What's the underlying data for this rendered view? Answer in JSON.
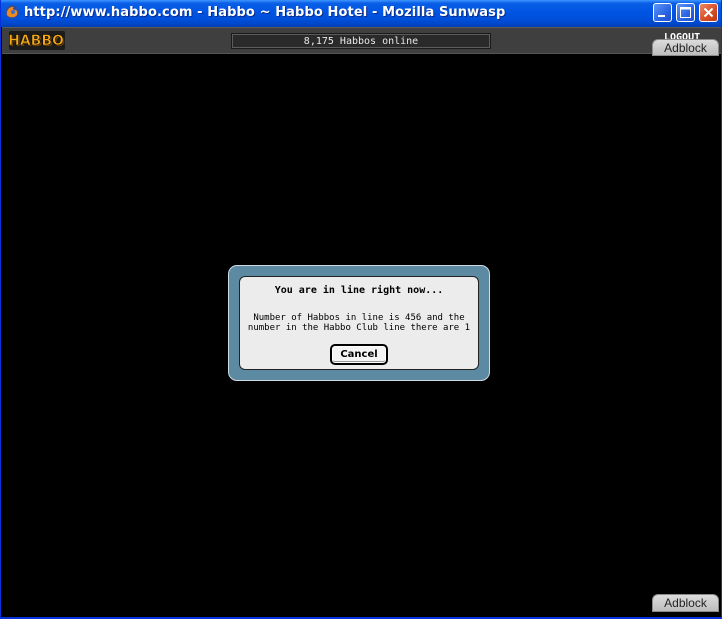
{
  "window": {
    "title": "http://www.habbo.com - Habbo ~ Habbo Hotel - Mozilla Sunwasp",
    "controls": [
      "minimize-icon",
      "maximize-icon",
      "close-icon"
    ]
  },
  "topbar": {
    "logo_text": "HABBO",
    "online_count": "8,175 Habbos online",
    "logout_label": "LOGOUT"
  },
  "adblock": {
    "top_label": "Adblock",
    "bottom_label": "Adblock"
  },
  "dialog": {
    "title": "You are in line right now...",
    "message": "Number of Habbos in line is 456 and the number in the Habbo Club line there are 1",
    "cancel_label": "Cancel"
  },
  "colors": {
    "titlebar": "#0054e3",
    "topbar": "#3f3f3f",
    "page_background": "#000000",
    "dialog_frame": "#5d8aa3",
    "dialog_body": "#ececec",
    "logo": "#f3a81c"
  }
}
